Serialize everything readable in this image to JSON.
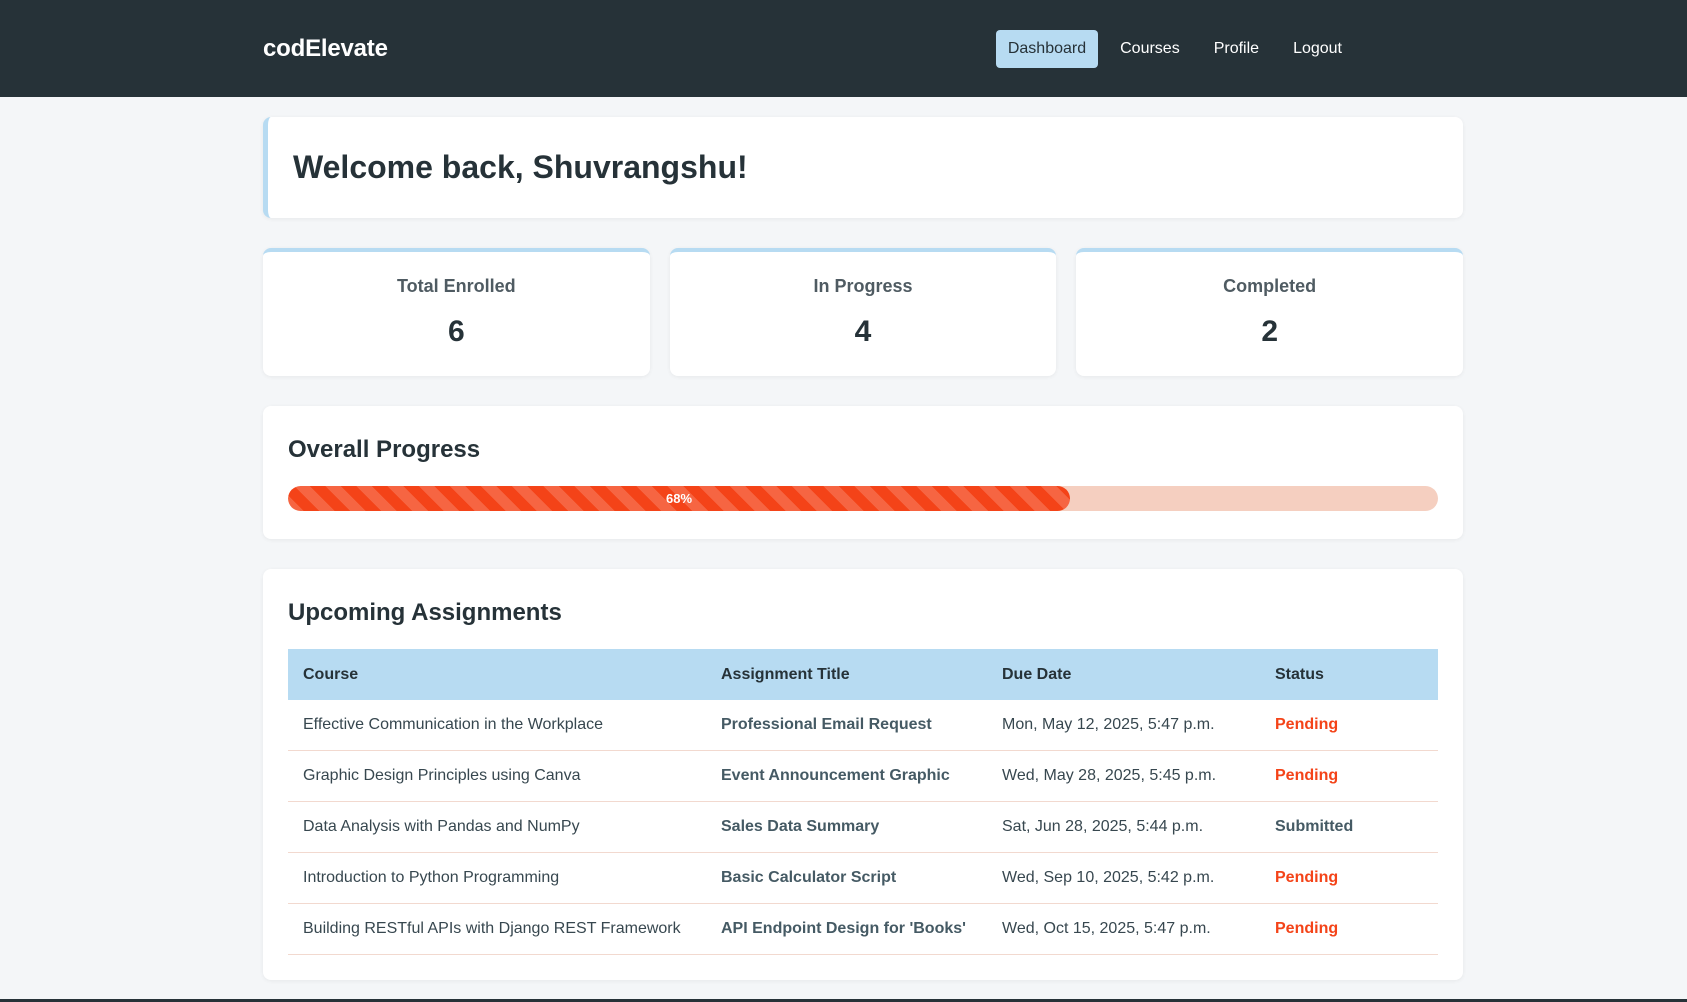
{
  "navbar": {
    "brand": "codElevate",
    "links": [
      {
        "label": "Dashboard",
        "active": true
      },
      {
        "label": "Courses",
        "active": false
      },
      {
        "label": "Profile",
        "active": false
      },
      {
        "label": "Logout",
        "active": false
      }
    ]
  },
  "welcome": {
    "title": "Welcome back, Shuvrangshu!"
  },
  "stats": [
    {
      "label": "Total Enrolled",
      "value": "6"
    },
    {
      "label": "In Progress",
      "value": "4"
    },
    {
      "label": "Completed",
      "value": "2"
    }
  ],
  "progress": {
    "title": "Overall Progress",
    "percent": 68,
    "percent_label": "68%"
  },
  "assignments": {
    "title": "Upcoming Assignments",
    "columns": [
      "Course",
      "Assignment Title",
      "Due Date",
      "Status"
    ],
    "rows": [
      {
        "course": "Effective Communication in the Workplace",
        "title": "Professional Email Request",
        "due": "Mon, May 12, 2025, 5:47 p.m.",
        "status": "Pending"
      },
      {
        "course": "Graphic Design Principles using Canva",
        "title": "Event Announcement Graphic",
        "due": "Wed, May 28, 2025, 5:45 p.m.",
        "status": "Pending"
      },
      {
        "course": "Data Analysis with Pandas and NumPy",
        "title": "Sales Data Summary",
        "due": "Sat, Jun 28, 2025, 5:44 p.m.",
        "status": "Submitted"
      },
      {
        "course": "Introduction to Python Programming",
        "title": "Basic Calculator Script",
        "due": "Wed, Sep 10, 2025, 5:42 p.m.",
        "status": "Pending"
      },
      {
        "course": "Building RESTful APIs with Django REST Framework",
        "title": "API Endpoint Design for 'Books'",
        "due": "Wed, Oct 15, 2025, 5:47 p.m.",
        "status": "Pending"
      }
    ]
  },
  "colors": {
    "nav_bg": "#263238",
    "accent": "#b7dbf2",
    "progress": "#f44318",
    "pending": "#f44318"
  }
}
